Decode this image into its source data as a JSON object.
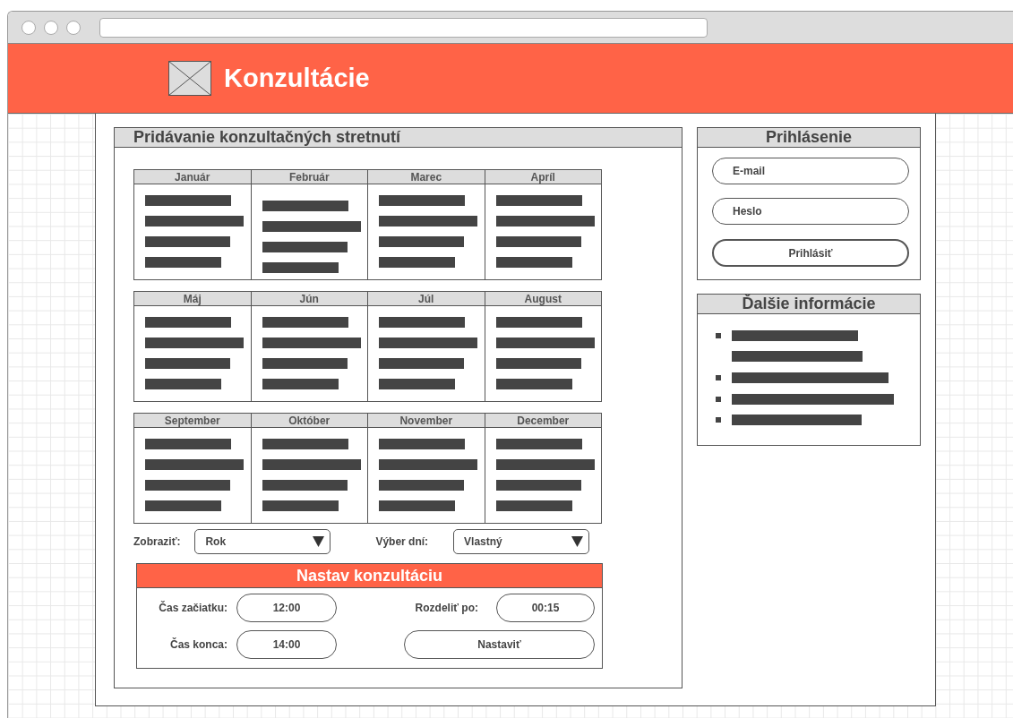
{
  "header": {
    "title": "Konzultácie"
  },
  "schedule_panel": {
    "title": "Pridávanie konzultačných stretnutí",
    "months": [
      "Január",
      "Február",
      "Marec",
      "Apríl",
      "Máj",
      "Jún",
      "Júl",
      "August",
      "September",
      "Október",
      "November",
      "December"
    ],
    "view": {
      "label": "Zobraziť:",
      "value": "Rok"
    },
    "day_selection": {
      "label": "Výber dní:",
      "value": "Vlastný"
    },
    "consultation_form": {
      "title": "Nastav konzultáciu",
      "start": {
        "label": "Čas začiatku:",
        "value": "12:00"
      },
      "split": {
        "label": "Rozdeliť po:",
        "value": "00:15"
      },
      "end": {
        "label": "Čas konca:",
        "value": "14:00"
      },
      "submit": "Nastaviť"
    }
  },
  "login_panel": {
    "title": "Prihlásenie",
    "email": {
      "placeholder": "E-mail"
    },
    "password": {
      "placeholder": "Heslo"
    },
    "submit": "Prihlásiť"
  },
  "info_panel": {
    "title": "Ďalšie informácie"
  }
}
